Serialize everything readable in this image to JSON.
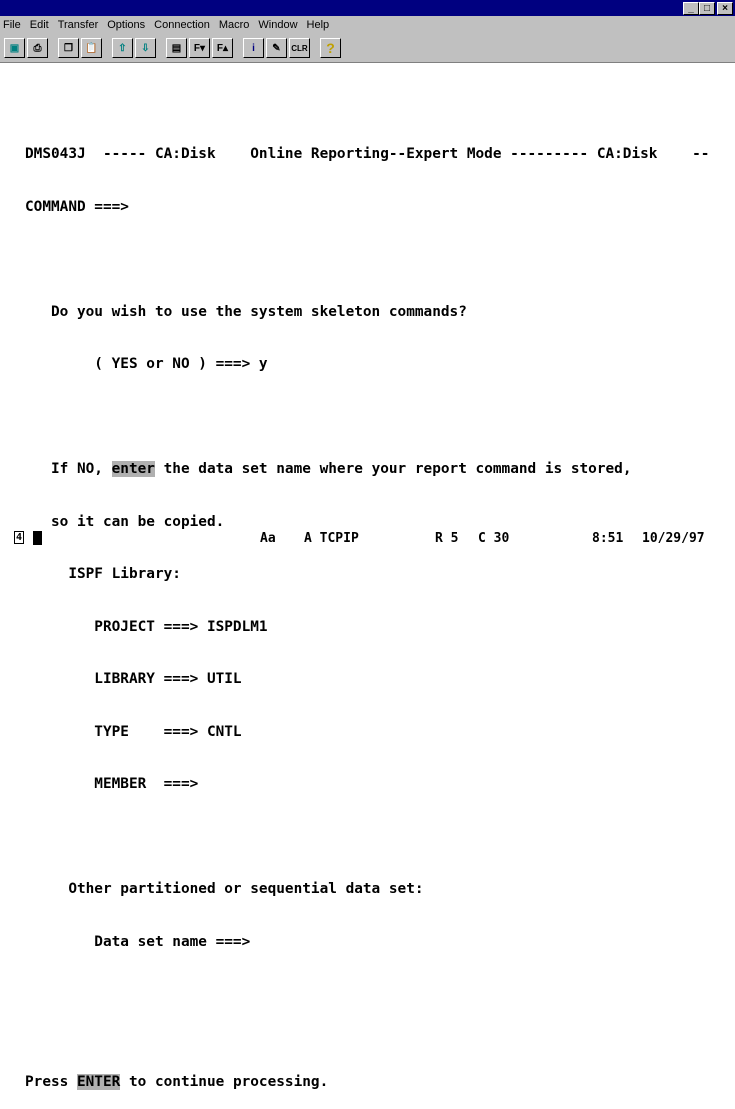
{
  "window": {
    "minimize": "_",
    "maximize": "□",
    "close": "×"
  },
  "menu": [
    "File",
    "Edit",
    "Transfer",
    "Options",
    "Connection",
    "Macro",
    "Window",
    "Help"
  ],
  "toolbar": [
    {
      "icon": "display-icon",
      "label": ""
    },
    {
      "icon": "print-icon",
      "label": ""
    },
    {
      "icon": "copy-icon",
      "label": ""
    },
    {
      "icon": "paste-icon",
      "label": ""
    },
    {
      "icon": "send-file-icon",
      "label": ""
    },
    {
      "icon": "receive-file-icon",
      "label": ""
    },
    {
      "icon": "color-palette-icon",
      "label": ""
    },
    {
      "icon": "font-down-icon",
      "label": "F▾"
    },
    {
      "icon": "font-up-icon",
      "label": "F▴"
    },
    {
      "icon": "info-icon",
      "label": "i"
    },
    {
      "icon": "macro-icon",
      "label": ""
    },
    {
      "icon": "clear-icon",
      "label": "CLR"
    },
    {
      "icon": "help-icon",
      "label": "?"
    }
  ],
  "screen": {
    "header": "DMS043J  ----- CA:Disk    Online Reporting--Expert Mode --------- CA:Disk    --",
    "command": "COMMAND ===>",
    "q1": "   Do you wish to use the system skeleton commands?",
    "q1_answer": "        ( YES or NO ) ===> y",
    "if_no_pre": "   If NO, ",
    "if_no_hl": "enter",
    "if_no_post": " the data set name where your report command is stored,",
    "copied": "   so it can be copied.",
    "ispf": "     ISPF Library:",
    "project": "        PROJECT ===> ISPDLM1",
    "library": "        LIBRARY ===> UTIL",
    "type": "        TYPE    ===> CNTL",
    "member": "        MEMBER  ===>",
    "other": "     Other partitioned or sequential data set:",
    "dsn": "        Data set name ===>",
    "press_pre": "Press ",
    "press_hl": "ENTER",
    "press_post": " to continue processing."
  },
  "status": {
    "session": "4",
    "font": "Aa",
    "mode": "A TCPIP",
    "row": "R 5",
    "col": "C 30",
    "time": "8:51",
    "date": "10/29/97"
  }
}
